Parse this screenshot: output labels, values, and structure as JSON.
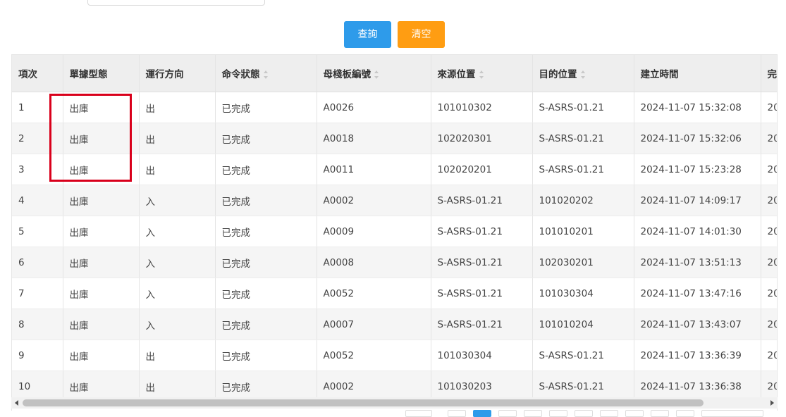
{
  "buttons": {
    "query": "查詢",
    "clear": "清空"
  },
  "table": {
    "columns": [
      {
        "label": "項次",
        "sortable": false
      },
      {
        "label": "單據型態",
        "sortable": false
      },
      {
        "label": "運行方向",
        "sortable": false
      },
      {
        "label": "命令狀態",
        "sortable": true
      },
      {
        "label": "母棧板編號",
        "sortable": true
      },
      {
        "label": "來源位置",
        "sortable": true
      },
      {
        "label": "目的位置",
        "sortable": true
      },
      {
        "label": "建立時間",
        "sortable": false
      },
      {
        "label": "完",
        "sortable": false
      }
    ],
    "rows": [
      [
        "1",
        "出庫",
        "出",
        "已完成",
        "A0026",
        "101010302",
        "S-ASRS-01.21",
        "2024-11-07 15:32:08",
        "20"
      ],
      [
        "2",
        "出庫",
        "出",
        "已完成",
        "A0018",
        "102020301",
        "S-ASRS-01.21",
        "2024-11-07 15:32:06",
        "20"
      ],
      [
        "3",
        "出庫",
        "出",
        "已完成",
        "A0011",
        "102020201",
        "S-ASRS-01.21",
        "2024-11-07 15:23:28",
        "20"
      ],
      [
        "4",
        "出庫",
        "入",
        "已完成",
        "A0002",
        "S-ASRS-01.21",
        "101020202",
        "2024-11-07 14:09:17",
        "20"
      ],
      [
        "5",
        "出庫",
        "入",
        "已完成",
        "A0009",
        "S-ASRS-01.21",
        "101010201",
        "2024-11-07 14:01:30",
        "20"
      ],
      [
        "6",
        "出庫",
        "入",
        "已完成",
        "A0008",
        "S-ASRS-01.21",
        "102030201",
        "2024-11-07 13:51:13",
        "20"
      ],
      [
        "7",
        "出庫",
        "入",
        "已完成",
        "A0052",
        "S-ASRS-01.21",
        "101030304",
        "2024-11-07 13:47:16",
        "20"
      ],
      [
        "8",
        "出庫",
        "入",
        "已完成",
        "A0007",
        "S-ASRS-01.21",
        "101010204",
        "2024-11-07 13:43:07",
        "20"
      ],
      [
        "9",
        "出庫",
        "出",
        "已完成",
        "A0052",
        "101030304",
        "S-ASRS-01.21",
        "2024-11-07 13:36:39",
        "20"
      ],
      [
        "10",
        "出庫",
        "出",
        "已完成",
        "A0002",
        "101030203",
        "S-ASRS-01.21",
        "2024-11-07 13:36:38",
        "20"
      ]
    ]
  },
  "colors": {
    "query_button": "#2e9bea",
    "clear_button": "#ff9d12",
    "highlight": "#d9001b"
  }
}
